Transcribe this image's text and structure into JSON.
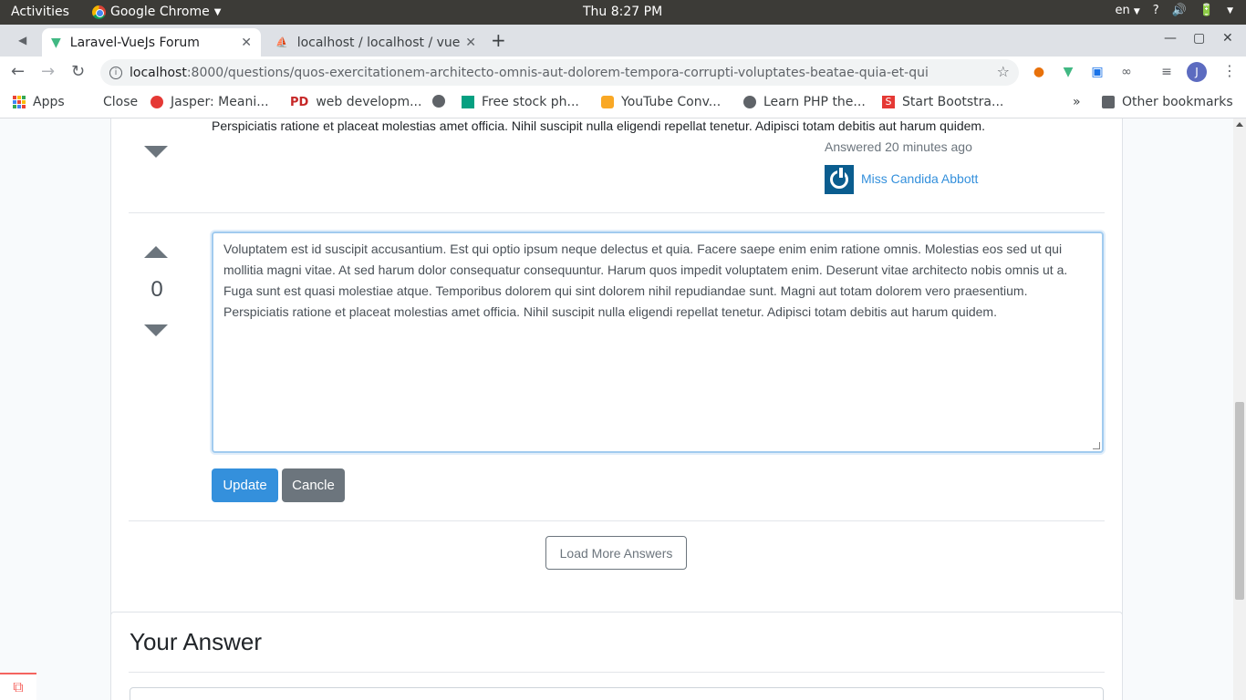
{
  "system": {
    "activities": "Activities",
    "app_name": "Google Chrome",
    "clock": "Thu  8:27 PM",
    "lang": "en",
    "help": "?",
    "volume_icon": "volume-icon",
    "battery_icon": "battery-icon"
  },
  "tabs": [
    {
      "title": "Laravel-VueJs Forum",
      "close": "✕"
    },
    {
      "title": "localhost / localhost / vue",
      "close": "✕"
    }
  ],
  "new_tab": "+",
  "window_controls": {
    "minimize": "—",
    "maximize": "▢",
    "close": "✕"
  },
  "toolbar": {
    "back": "←",
    "forward": "→",
    "reload": "↻",
    "url_host": "localhost",
    "url_path": ":8000/questions/quos-exercitationem-architecto-omnis-aut-dolorem-tempora-corrupti-voluptates-beatae-quia-et-qui",
    "star": "☆",
    "profile_initial": "J"
  },
  "bookmarks": {
    "apps": "Apps",
    "items": [
      "Close",
      "Jasper: Meani...",
      "web developm...",
      "Free stock ph...",
      "YouTube Conv...",
      "Learn PHP the...",
      "Start Bootstra..."
    ],
    "overflow": "»",
    "other": "Other bookmarks"
  },
  "answer_prev": {
    "text_tail": "Perspiciatis ratione et placeat molestias amet officia. Nihil suscipit nulla eligendi repellat tenetur. Adipisci totam debitis aut harum quidem.",
    "answered": "Answered 20 minutes ago",
    "author": "Miss Candida Abbott"
  },
  "answer_edit": {
    "votes": "0",
    "body": "Voluptatem est id suscipit accusantium. Est qui optio ipsum neque delectus et quia. Facere saepe enim enim ratione omnis. Molestias eos sed ut qui mollitia magni vitae. At sed harum dolor consequatur consequuntur. Harum quos impedit voluptatem enim. Deserunt vitae architecto nobis omnis ut a. Fuga sunt est quasi molestiae atque. Temporibus dolorem qui sint dolorem nihil repudiandae sunt. Magni aut totam dolorem vero praesentium. Perspiciatis ratione et placeat molestias amet officia. Nihil suscipit nulla eligendi repellat tenetur. Adipisci totam debitis aut harum quidem.",
    "update_label": "Update",
    "cancel_label": "Cancle"
  },
  "load_more_label": "Load More Answers",
  "your_answer_title": "Your Answer",
  "colors": {
    "primary": "#3490dc",
    "secondary": "#6c757d",
    "topbar": "#3c3b37"
  }
}
